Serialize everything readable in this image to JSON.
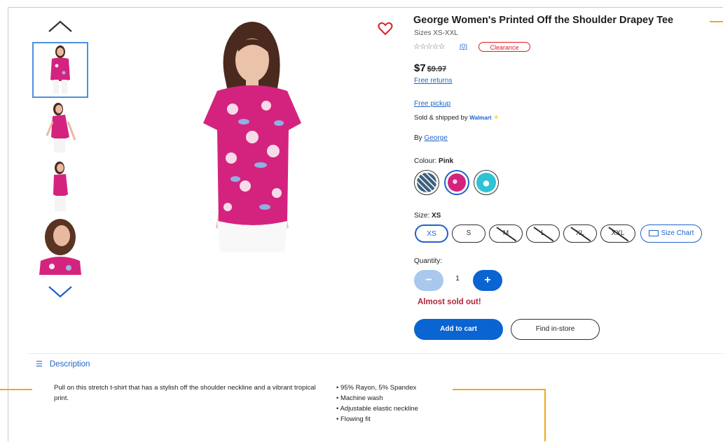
{
  "product": {
    "title": "George Women's Printed Off the Shoulder Drapey Tee",
    "sizes_range": "Sizes XS-XXL",
    "stars": "☆☆☆☆☆",
    "review_count": "(0)",
    "badge": "Clearance",
    "price": "$7",
    "old_price": "$9.97",
    "free_returns": "Free returns",
    "free_pickup": "Free pickup",
    "sold_by_text": "Sold & shipped by",
    "sold_by_brand": "Walmart",
    "brand_prefix": "By",
    "brand": "George",
    "colour_label": "Colour:",
    "colour_value": "Pink",
    "size_label": "Size:",
    "size_value": "XS",
    "sizes": [
      "XS",
      "S",
      "M",
      "L",
      "XL",
      "XXL"
    ],
    "size_chart": "Size Chart",
    "quantity_label": "Quantity:",
    "quantity": "1",
    "minus": "−",
    "plus": "+",
    "stock_status": "Almost sold out!",
    "add_to_cart": "Add to cart",
    "find_in_store": "Find in-store"
  },
  "description": {
    "heading": "Description",
    "text": "Pull on this stretch t-shirt that has a stylish off the shoulder neckline and a vibrant tropical print.",
    "bullets": [
      "95% Rayon, 5% Spandex",
      "Machine wash",
      "Adjustable elastic neckline",
      "Flowing fit"
    ]
  },
  "colors": {
    "accent": "#0a64d2",
    "link": "#1e64c8",
    "clearance": "#de1c24",
    "alert": "#b2243a",
    "annotation": "#f2a81d",
    "swatches": [
      "#3e5f7a",
      "#d4237f",
      "#2cc3d4"
    ]
  }
}
